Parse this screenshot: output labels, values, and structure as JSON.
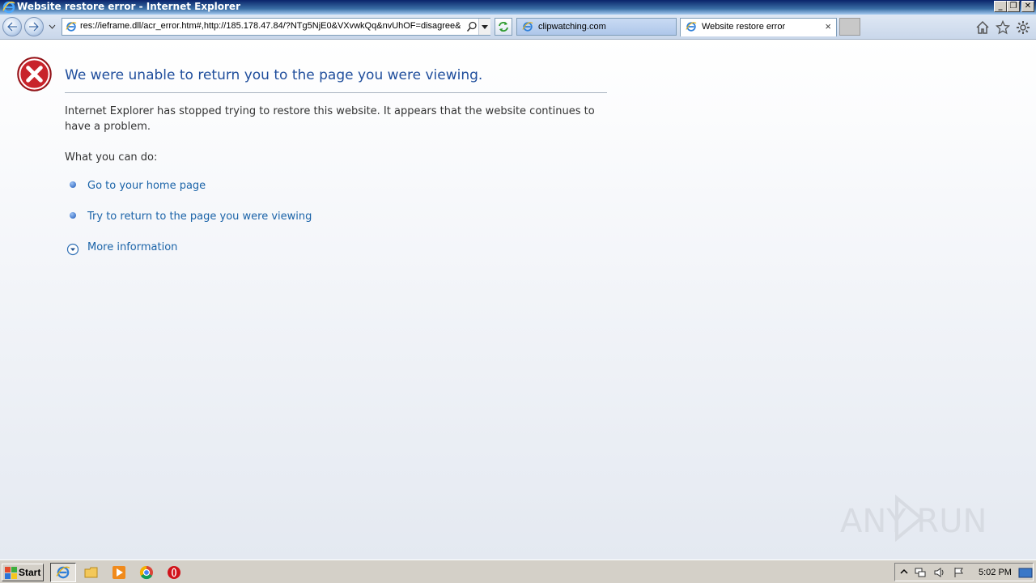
{
  "window": {
    "title": "Website restore error - Internet Explorer",
    "controls": [
      "minimize",
      "restore",
      "close"
    ]
  },
  "navbar": {
    "address": "res://ieframe.dll/acr_error.htm#,http://185.178.47.84/?NTg5NjE0&VXvwkQq&nvUhOF=disagree&",
    "tabs": [
      {
        "label": "clipwatching.com",
        "active": false
      },
      {
        "label": "Website restore error",
        "active": true
      }
    ],
    "close_tab_glyph": "×"
  },
  "page": {
    "heading": "We were unable to return you to the page you were viewing.",
    "description": "Internet Explorer has stopped trying to restore this website. It appears that the website continues to have a problem.",
    "what_you_can_do": "What you can do:",
    "links": {
      "home": "Go to your home page",
      "return": "Try to return to the page you were viewing",
      "more": "More information"
    }
  },
  "watermark": {
    "text": "ANY RUN"
  },
  "taskbar": {
    "start_label": "Start",
    "pinned": [
      "internet-explorer-icon",
      "folder-icon",
      "media-player-icon",
      "chrome-icon",
      "opera-icon"
    ],
    "clock": "5:02 PM"
  },
  "colors": {
    "heading": "#1f4e9c",
    "link": "#1a63a8",
    "error_red": "#c8232b",
    "titlebar": "#0a246a"
  }
}
